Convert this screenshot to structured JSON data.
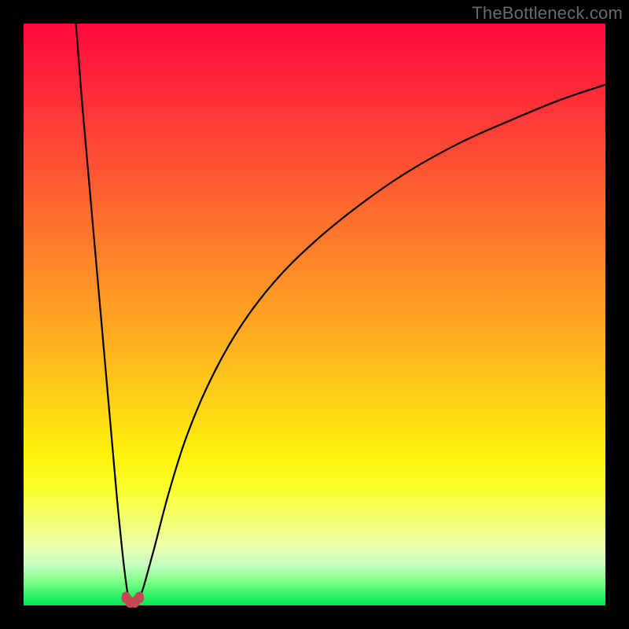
{
  "watermark": "TheBottleneck.com",
  "colors": {
    "frame": "#000000",
    "gradient_top": "#ff0a3c",
    "gradient_bottom": "#00e752",
    "curve": "#000000",
    "markers": "#c44a56"
  },
  "chart_data": {
    "type": "line",
    "title": "",
    "xlabel": "",
    "ylabel": "",
    "xlim": [
      0,
      100
    ],
    "ylim": [
      0,
      100
    ],
    "notes": "No axes, ticks, or labels are rendered. V-shaped curve reaches its minimum (y≈0) near x≈18. Left branch rises sharply to the top-left corner (x≈9, y≈100). Right branch rises with decreasing slope toward the top-right edge (x=100, y≈90). Values are estimated from pixel positions since no numeric scale is shown.",
    "series": [
      {
        "name": "left-branch",
        "x": [
          9.0,
          10.0,
          11.5,
          13.0,
          14.5,
          16.0,
          17.0,
          17.6,
          18.0,
          18.5,
          19.0
        ],
        "y": [
          100.0,
          87.0,
          70.0,
          53.0,
          36.0,
          19.0,
          9.0,
          4.0,
          1.5,
          0.5,
          0.3
        ]
      },
      {
        "name": "right-branch",
        "x": [
          19.0,
          19.5,
          20.0,
          20.5,
          21.0,
          22.5,
          25.0,
          28.0,
          32.0,
          37.0,
          43.0,
          50.0,
          58.0,
          66.0,
          75.0,
          84.0,
          92.0,
          100.0
        ],
        "y": [
          0.3,
          0.6,
          1.5,
          2.8,
          4.5,
          10.0,
          19.5,
          29.0,
          38.5,
          47.5,
          55.5,
          62.5,
          69.0,
          74.5,
          79.5,
          83.5,
          86.8,
          89.5
        ]
      }
    ],
    "markers": {
      "name": "bottom-markers",
      "shape": "round",
      "color": "#c44a56",
      "points": [
        {
          "x": 17.6,
          "y": 1.2
        },
        {
          "x": 18.3,
          "y": 0.4
        },
        {
          "x": 19.1,
          "y": 0.4
        },
        {
          "x": 19.9,
          "y": 1.2
        }
      ]
    }
  }
}
